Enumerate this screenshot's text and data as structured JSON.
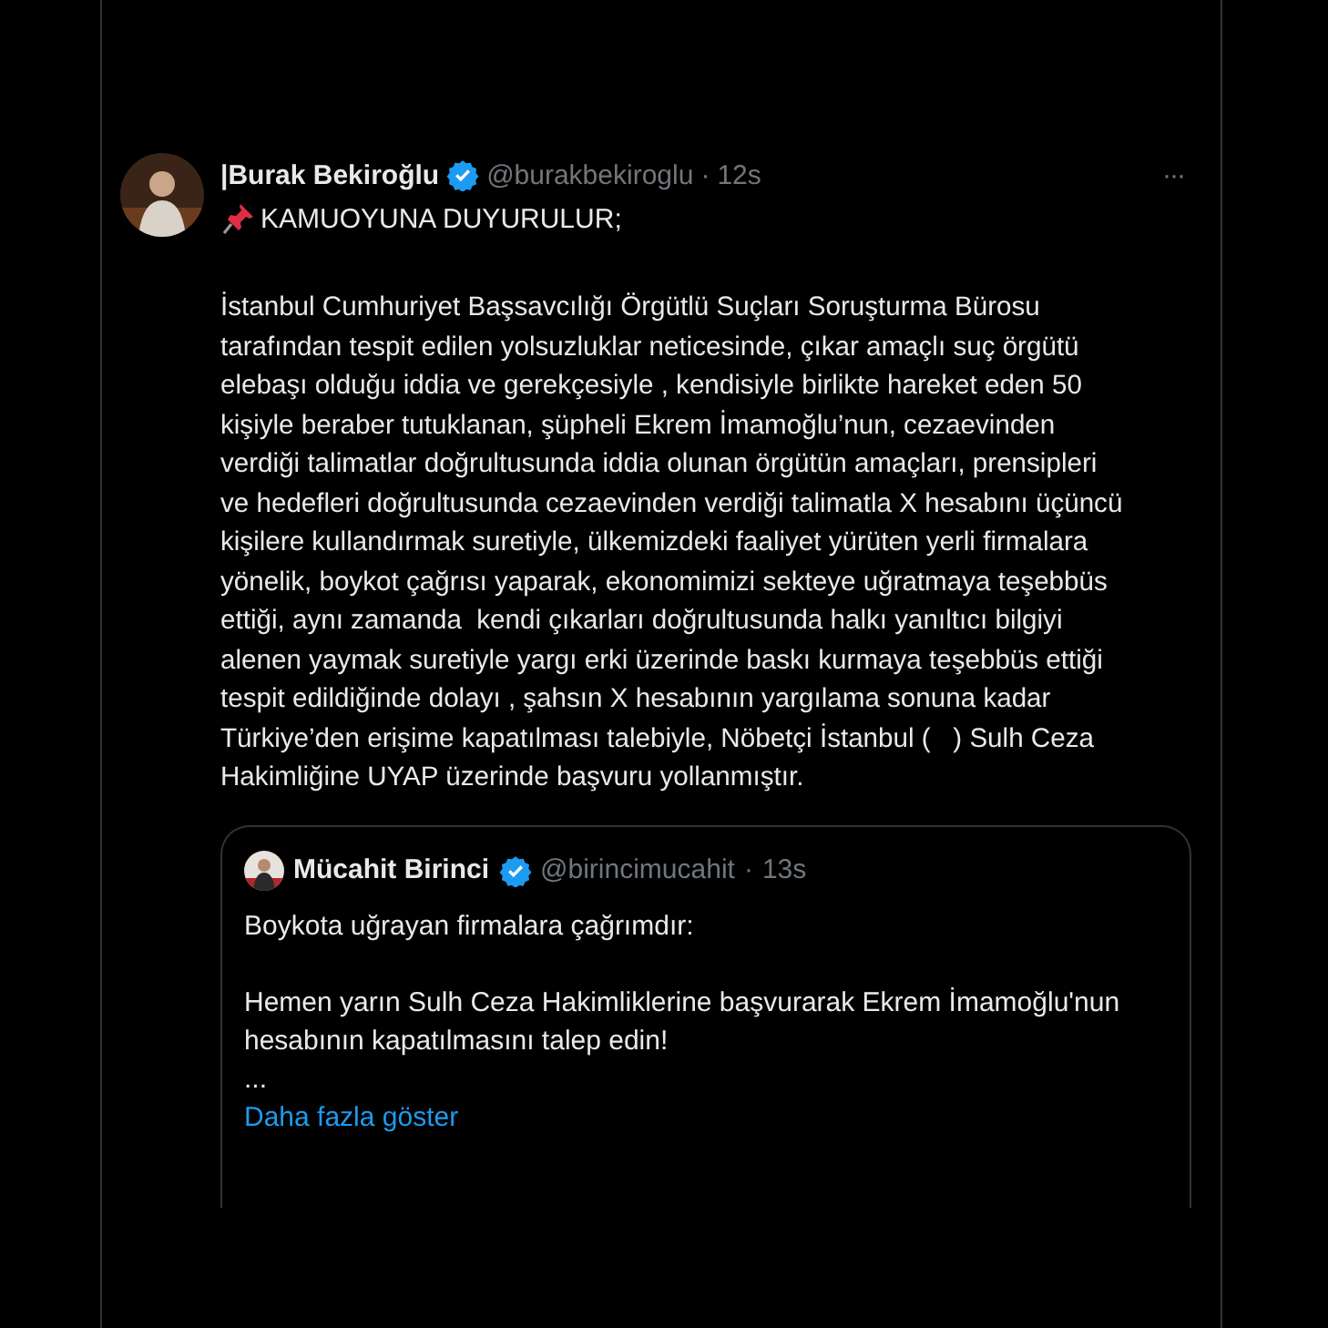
{
  "post": {
    "author": {
      "name": "|Burak Bekiroğlu",
      "verified": true,
      "handle": "@burakbekiroglu",
      "separator": "·",
      "time": "12s"
    },
    "more_button": "···",
    "headline": "KAMUOYUNA DUYURULUR;",
    "body_lines": [
      "İstanbul Cumhuriyet Başsavcılığı Örgütlü Suçları Soruşturma Bürosu",
      "tarafından tespit edilen yolsuzluklar neticesinde, çıkar amaçlı suç örgütü",
      "elebaşı olduğu iddia ve gerekçesiyle , kendisiyle birlikte hareket eden 50",
      "kişiyle beraber tutuklanan, şüpheli Ekrem İmamoğlu’nun, cezaevinden",
      "verdiği talimatlar doğrultusunda iddia olunan örgütün amaçları, prensipleri",
      "ve hedefleri doğrultusunda cezaevinden verdiği talimatla X hesabını üçüncü",
      "kişilere kullandırmak suretiyle, ülkemizdeki faaliyet yürüten yerli firmalara",
      "yönelik, boykot çağrısı yaparak, ekonomimizi sekteye uğratmaya teşebbüs",
      "ettiği, aynı zamanda  kendi çıkarları doğrultusunda halkı yanıltıcı bilgiyi",
      "alenen yaymak suretiyle yargı erki üzerinde baskı kurmaya teşebbüs ettiği",
      "tespit edildiğinde dolayı , şahsın X hesabının yargılama sonuna kadar",
      "Türkiye’den erişime kapatılması talebiyle, Nöbetçi İstanbul (   ) Sulh Ceza",
      "Hakimliğine UYAP üzerinde başvuru yollanmıştır."
    ],
    "quote": {
      "author": {
        "name": "Mücahit Birinci",
        "verified": true,
        "handle": "@birincimucahit",
        "separator": "·",
        "time": "13s"
      },
      "paragraphs": [
        "Boykota uğrayan firmalara çağrımdır:",
        "Hemen yarın Sulh Ceza Hakimliklerine başvurarak Ekrem İmamoğlu'nun hesabının kapatılmasını talep edin!",
        "..."
      ],
      "show_more": "Daha fazla göster"
    }
  }
}
